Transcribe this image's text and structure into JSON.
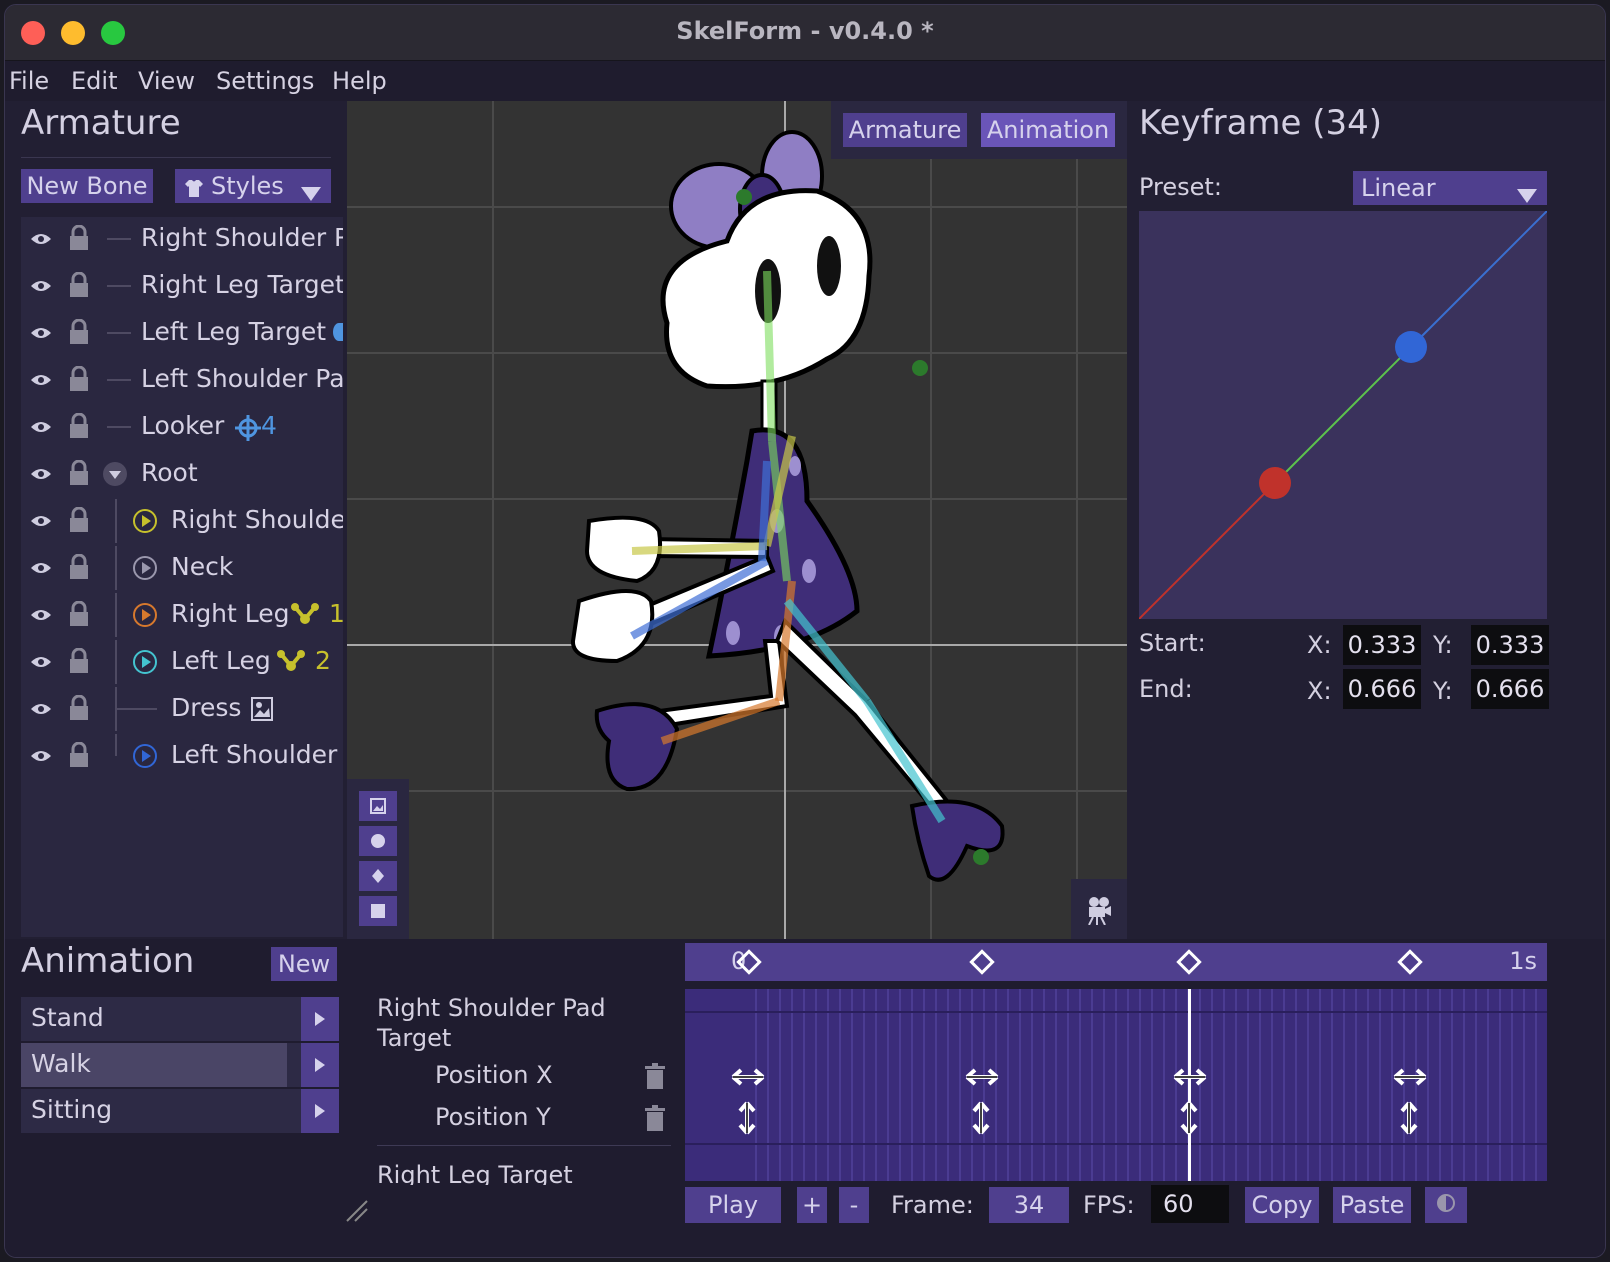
{
  "window": {
    "title": "SkelForm - v0.4.0 *"
  },
  "menu": [
    "File",
    "Edit",
    "View",
    "Settings",
    "Help"
  ],
  "armature_panel": {
    "title": "Armature",
    "new_bone_label": "New Bone",
    "styles_label": "Styles",
    "bones": [
      {
        "name": "Right Shoulder Pa",
        "badge": ""
      },
      {
        "name": "Right Leg Target",
        "badge": ""
      },
      {
        "name": "Left Leg Target",
        "badge": ""
      },
      {
        "name": "Left Shoulder Pac",
        "badge": ""
      },
      {
        "name": "Looker",
        "badge": "4"
      },
      {
        "name": "Root",
        "badge": ""
      },
      {
        "name": "Right Shoulder",
        "badge": ""
      },
      {
        "name": "Neck",
        "badge": ""
      },
      {
        "name": "Right Leg",
        "badge": "1"
      },
      {
        "name": "Left Leg",
        "badge": "2"
      },
      {
        "name": "Dress",
        "badge": ""
      },
      {
        "name": "Left Shoulder F",
        "badge": ""
      }
    ]
  },
  "viewport": {
    "mode_tabs": [
      "Armature",
      "Animation"
    ]
  },
  "keyframe_panel": {
    "title": "Keyframe (34)",
    "preset_label": "Preset:",
    "preset_value": "Linear",
    "start_label": "Start:",
    "end_label": "End:",
    "x_label": "X:",
    "y_label": "Y:",
    "start_x": "0.333",
    "start_y": "0.333",
    "end_x": "0.666",
    "end_y": "0.666"
  },
  "animation_panel": {
    "title": "Animation",
    "new_label": "New",
    "animations": [
      "Stand",
      "Walk",
      "Sitting"
    ],
    "selected_animation": "Walk",
    "tracks_group_1": "Right Shoulder Pad Target",
    "track_position_x": "Position X",
    "track_position_y": "Position Y",
    "tracks_group_2": "Right Leg Target",
    "ruler_start": "0",
    "ruler_end": "1s",
    "play_label": "Play",
    "plus_label": "+",
    "minus_label": "-",
    "frame_label": "Frame:",
    "frame_value": "34",
    "fps_label": "FPS:",
    "fps_value": "60",
    "copy_label": "Copy",
    "paste_label": "Paste"
  },
  "colors": {
    "accent": "#4f3f8e",
    "panel": "#221f33",
    "viewport": "#333333"
  }
}
